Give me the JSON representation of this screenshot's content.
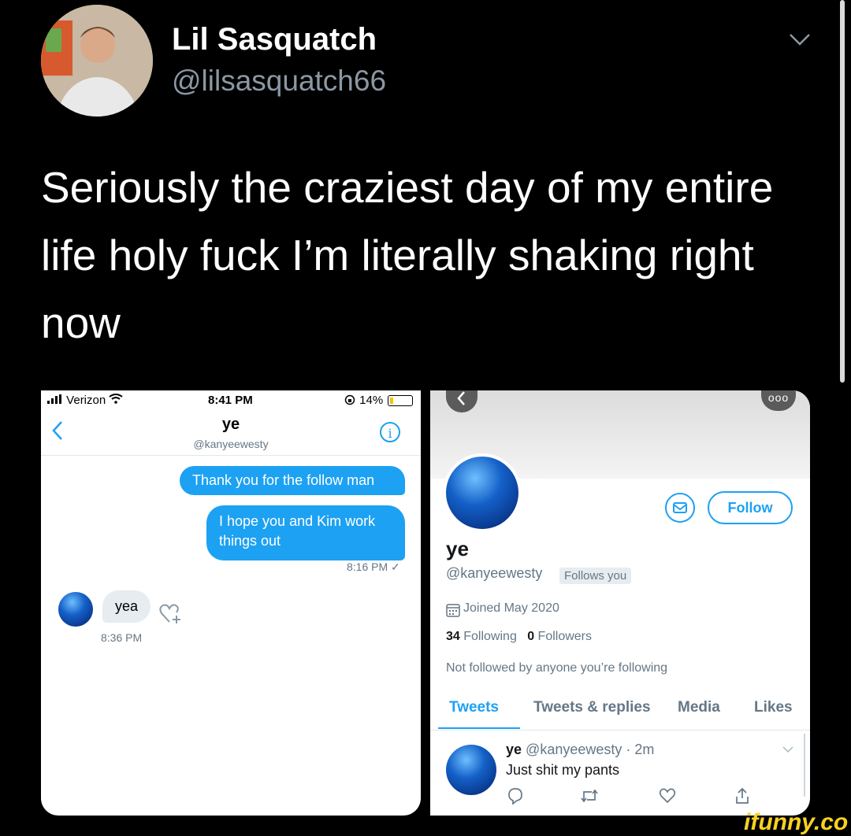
{
  "tweet": {
    "author_name": "Lil Sasquatch",
    "author_handle": "@lilsasquatch66",
    "text": "Seriously the craziest day of my entire life holy fuck I’m literally shaking right now"
  },
  "dm_screenshot": {
    "status_bar": {
      "carrier": "Verizon",
      "time": "8:41 PM",
      "battery": "14%"
    },
    "header": {
      "name": "ye",
      "handle": "@kanyeewesty"
    },
    "messages_sent": [
      "Thank you for the follow man",
      "I hope you and Kim work things out"
    ],
    "sent_time": "8:16 PM ✓",
    "message_received": "yea",
    "received_time": "8:36 PM"
  },
  "profile_screenshot": {
    "menu_label": "ooo",
    "follow_label": "Follow",
    "name": "ye",
    "handle": "@kanyeewesty",
    "follows_you": "Follows you",
    "joined": "Joined May 2020",
    "following_count": "34",
    "following_label": "Following",
    "followers_count": "0",
    "followers_label": "Followers",
    "not_followed": "Not followed by anyone you’re following",
    "tabs": [
      "Tweets",
      "Tweets & replies",
      "Media",
      "Likes"
    ],
    "tweet": {
      "name": "ye",
      "meta": "@kanyeewesty · 2m",
      "text": "Just shit my pants"
    }
  },
  "watermark": "ifunny.co",
  "colors": {
    "accent": "#1da1f2",
    "background": "#000000",
    "watermark": "#f9d21f"
  }
}
